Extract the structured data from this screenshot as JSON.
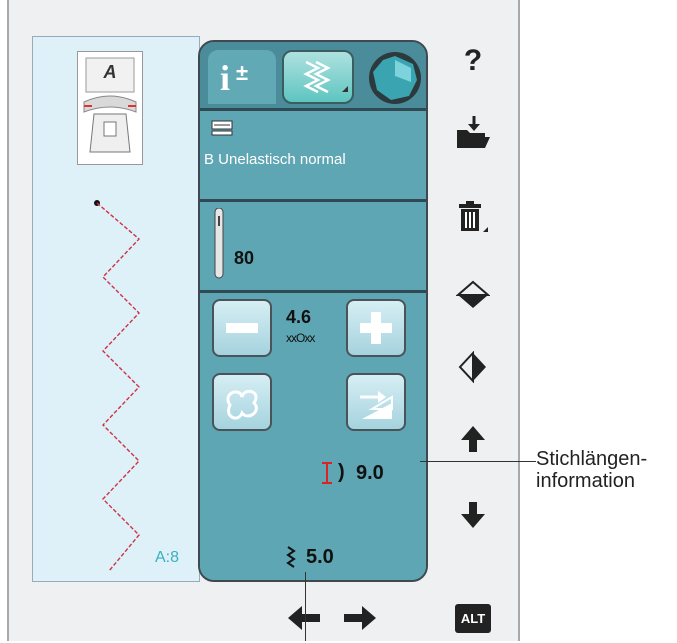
{
  "presser_foot": {
    "letter": "A"
  },
  "stitch_preview": {
    "stitch_code": "A:8"
  },
  "panel": {
    "tabs": {
      "info_icon": "info-plus-minus-icon",
      "stitch_icon": "stitch-settings-icon",
      "color_icon": "color-gem-icon"
    },
    "fabric_icon": "fabric-icon",
    "fabric_label": "B Unelastisch normal",
    "needle_size": "80",
    "stitch_width_value": "4.6",
    "stitch_positioning_symbol": "xxOxx",
    "stitch_length_value": "9.0",
    "stitch_density_value": "5.0"
  },
  "sidebar": {
    "help_icon": "help-icon",
    "save_icon": "folder-save-icon",
    "delete_icon": "trash-icon",
    "mirror_side_icon": "mirror-side-icon",
    "mirror_end_icon": "mirror-end-icon",
    "up_icon": "arrow-up-icon",
    "down_icon": "arrow-down-icon",
    "alt_label": "ALT"
  },
  "bottom_nav": {
    "left_icon": "arrow-left-icon",
    "right_icon": "arrow-right-icon"
  },
  "callouts": {
    "stitch_length_info": "Stichlängen-\ninformation"
  },
  "colors": {
    "panel": "#4e93a1",
    "stitch_line": "#cc3344",
    "stitch_code": "#3ab0c0"
  }
}
